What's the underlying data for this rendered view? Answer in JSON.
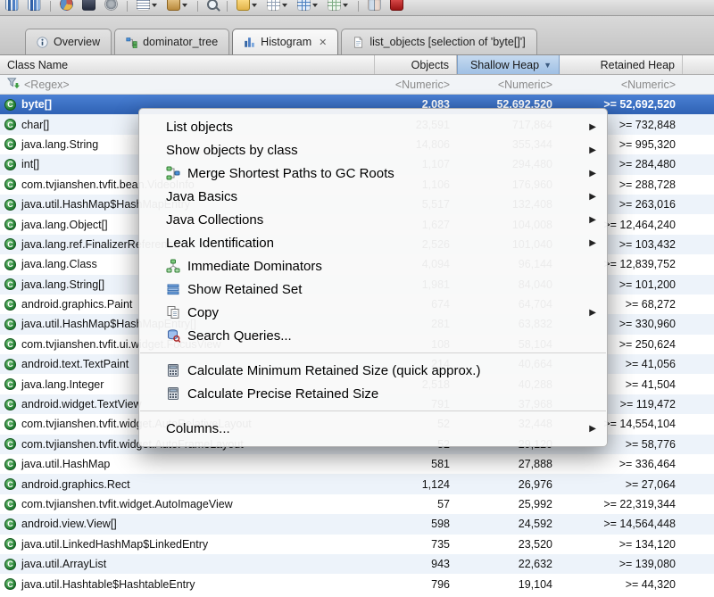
{
  "icons": {
    "class_glyph": "C",
    "close_glyph": "✕",
    "submenu_arrow": "▶",
    "sort_indicator": "▼"
  },
  "toolbar": {
    "icons": [
      {
        "name": "chart"
      },
      {
        "name": "histogram"
      },
      {
        "name": "separator"
      },
      {
        "name": "overview"
      },
      {
        "name": "oql"
      },
      {
        "name": "gear"
      },
      {
        "name": "separator"
      },
      {
        "name": "list",
        "dd": true
      },
      {
        "name": "package",
        "dd": true
      },
      {
        "name": "separator"
      },
      {
        "name": "search"
      },
      {
        "name": "separator"
      },
      {
        "name": "folder",
        "dd": true
      },
      {
        "name": "grid",
        "dd": true
      },
      {
        "name": "gridblue",
        "dd": true
      },
      {
        "name": "grid2",
        "dd": true
      },
      {
        "name": "separator"
      },
      {
        "name": "compare"
      },
      {
        "name": "stop",
        "right": true
      }
    ]
  },
  "tabs": [
    {
      "label": "Overview",
      "icon": "info"
    },
    {
      "label": "dominator_tree",
      "icon": "tree"
    },
    {
      "label": "Histogram",
      "icon": "histogram",
      "active": true,
      "closable": true
    },
    {
      "label": "list_objects [selection of 'byte[]']",
      "icon": "document"
    }
  ],
  "table": {
    "columns": {
      "class_name": "Class Name",
      "objects": "Objects",
      "shallow": "Shallow Heap",
      "retained": "Retained Heap"
    },
    "sort": {
      "column": "Shallow Heap",
      "direction": "descending"
    },
    "filters": {
      "class_name": "<Regex>",
      "objects": "<Numeric>",
      "shallow": "<Numeric>",
      "retained": "<Numeric>"
    },
    "rows": [
      {
        "name": "byte[]",
        "objects": "2,083",
        "shallow": "52,692,520",
        "retained": ">= 52,692,520",
        "selected": true
      },
      {
        "name": "char[]",
        "objects": "23,591",
        "shallow": "717,864",
        "retained": ">= 732,848"
      },
      {
        "name": "java.lang.String",
        "objects": "14,806",
        "shallow": "355,344",
        "retained": ">= 995,320"
      },
      {
        "name": "int[]",
        "objects": "1,107",
        "shallow": "294,480",
        "retained": ">= 284,480"
      },
      {
        "name": "com.tvjianshen.tvfit.bean.VideoInfo",
        "objects": "1,106",
        "shallow": "176,960",
        "retained": ">= 288,728"
      },
      {
        "name": "java.util.HashMap$HashMapEntry",
        "objects": "5,517",
        "shallow": "132,408",
        "retained": ">= 263,016"
      },
      {
        "name": "java.lang.Object[]",
        "objects": "1,627",
        "shallow": "104,008",
        "retained": ">= 12,464,240"
      },
      {
        "name": "java.lang.ref.FinalizerReference",
        "objects": "2,526",
        "shallow": "101,040",
        "retained": ">= 103,432"
      },
      {
        "name": "java.lang.Class",
        "objects": "4,094",
        "shallow": "96,144",
        "retained": ">= 12,839,752"
      },
      {
        "name": "java.lang.String[]",
        "objects": "1,981",
        "shallow": "84,040",
        "retained": ">= 101,200"
      },
      {
        "name": "android.graphics.Paint",
        "objects": "674",
        "shallow": "64,704",
        "retained": ">= 68,272"
      },
      {
        "name": "java.util.HashMap$HashMapEntry[]",
        "objects": "281",
        "shallow": "63,832",
        "retained": ">= 330,960"
      },
      {
        "name": "com.tvjianshen.tvfit.ui.widget.FocusView",
        "objects": "108",
        "shallow": "58,104",
        "retained": ">= 250,624"
      },
      {
        "name": "android.text.TextPaint",
        "objects": "214",
        "shallow": "40,664",
        "retained": ">= 41,056"
      },
      {
        "name": "java.lang.Integer",
        "objects": "2,518",
        "shallow": "40,288",
        "retained": ">= 41,504"
      },
      {
        "name": "android.widget.TextView",
        "objects": "791",
        "shallow": "37,968",
        "retained": ">= 119,472"
      },
      {
        "name": "com.tvjianshen.tvfit.widget.AutoRelativeLayout",
        "objects": "52",
        "shallow": "32,448",
        "retained": ">= 14,554,104"
      },
      {
        "name": "com.tvjianshen.tvfit.widget.AutoFrameLayout",
        "objects": "52",
        "shallow": "29,120",
        "retained": ">= 58,776"
      },
      {
        "name": "java.util.HashMap",
        "objects": "581",
        "shallow": "27,888",
        "retained": ">= 336,464"
      },
      {
        "name": "android.graphics.Rect",
        "objects": "1,124",
        "shallow": "26,976",
        "retained": ">= 27,064"
      },
      {
        "name": "com.tvjianshen.tvfit.widget.AutoImageView",
        "objects": "57",
        "shallow": "25,992",
        "retained": ">= 22,319,344"
      },
      {
        "name": "android.view.View[]",
        "objects": "598",
        "shallow": "24,592",
        "retained": ">= 14,564,448"
      },
      {
        "name": "java.util.LinkedHashMap$LinkedEntry",
        "objects": "735",
        "shallow": "23,520",
        "retained": ">= 134,120"
      },
      {
        "name": "java.util.ArrayList",
        "objects": "943",
        "shallow": "22,632",
        "retained": ">= 139,080"
      },
      {
        "name": "java.util.Hashtable$HashtableEntry",
        "objects": "796",
        "shallow": "19,104",
        "retained": ">= 44,320"
      }
    ]
  },
  "menu": {
    "items": [
      {
        "label": "List objects",
        "icon": "",
        "submenu": true
      },
      {
        "label": "Show objects by class",
        "icon": "",
        "submenu": true
      },
      {
        "label": "Merge Shortest Paths to GC Roots",
        "icon": "merge-paths",
        "submenu": true
      },
      {
        "label": "Java Basics",
        "icon": "",
        "submenu": true
      },
      {
        "label": "Java Collections",
        "icon": "",
        "submenu": true
      },
      {
        "label": "Leak Identification",
        "icon": "",
        "submenu": true
      },
      {
        "label": "Immediate Dominators",
        "icon": "immediate-dominators"
      },
      {
        "label": "Show Retained Set",
        "icon": "retained-set"
      },
      {
        "label": "Copy",
        "icon": "copy",
        "submenu": true
      },
      {
        "label": "Search Queries...",
        "icon": "search-queries"
      },
      {
        "separator": true
      },
      {
        "label": "Calculate Minimum Retained Size (quick approx.)",
        "icon": "calculator"
      },
      {
        "label": "Calculate Precise Retained Size",
        "icon": "calculator"
      },
      {
        "separator": true
      },
      {
        "label": "Columns...",
        "icon": "",
        "submenu": true
      }
    ]
  }
}
